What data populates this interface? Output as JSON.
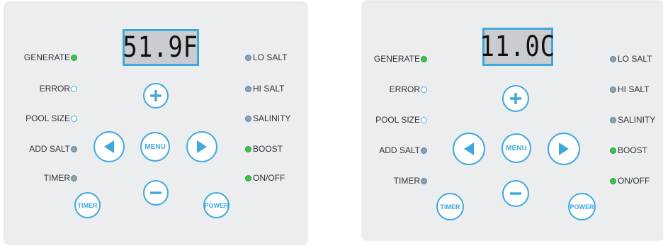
{
  "left_panel": {
    "display": "51.9F",
    "left_indicators": [
      {
        "label": "GENERATE",
        "state": "on"
      },
      {
        "label": "ERROR",
        "state": "off"
      },
      {
        "label": "POOL SIZE",
        "state": "off"
      },
      {
        "label": "ADD SALT",
        "state": "dim"
      },
      {
        "label": "TIMER",
        "state": "dim"
      }
    ],
    "right_indicators": [
      {
        "label": "LO SALT",
        "state": "dim"
      },
      {
        "label": "HI SALT",
        "state": "dim"
      },
      {
        "label": "SALINITY",
        "state": "dim"
      },
      {
        "label": "BOOST",
        "state": "on"
      },
      {
        "label": "ON/OFF",
        "state": "on"
      }
    ],
    "buttons": {
      "menu": "MENU",
      "timer": "TIMER",
      "power": "POWER"
    }
  },
  "right_panel": {
    "display": "11.0C",
    "left_indicators": [
      {
        "label": "GENERATE",
        "state": "on"
      },
      {
        "label": "ERROR",
        "state": "off"
      },
      {
        "label": "POOL SIZE",
        "state": "off"
      },
      {
        "label": "ADD SALT",
        "state": "dim"
      },
      {
        "label": "TIMER",
        "state": "dim"
      }
    ],
    "right_indicators": [
      {
        "label": "LO SALT",
        "state": "dim"
      },
      {
        "label": "HI SALT",
        "state": "dim"
      },
      {
        "label": "SALINITY",
        "state": "dim"
      },
      {
        "label": "BOOST",
        "state": "on"
      },
      {
        "label": "ON/OFF",
        "state": "on"
      }
    ],
    "buttons": {
      "menu": "MENU",
      "timer": "TIMER",
      "power": "POWER"
    }
  },
  "colors": {
    "accent": "#3fa9de",
    "led_on": "#3cc34b",
    "led_dim": "#8fa1ad",
    "panel": "#ecedef",
    "lcd": "#c9ccd0"
  },
  "icons": {
    "up": "plus-icon",
    "down": "minus-icon",
    "left": "left-arrow-icon",
    "right": "right-arrow-icon"
  }
}
